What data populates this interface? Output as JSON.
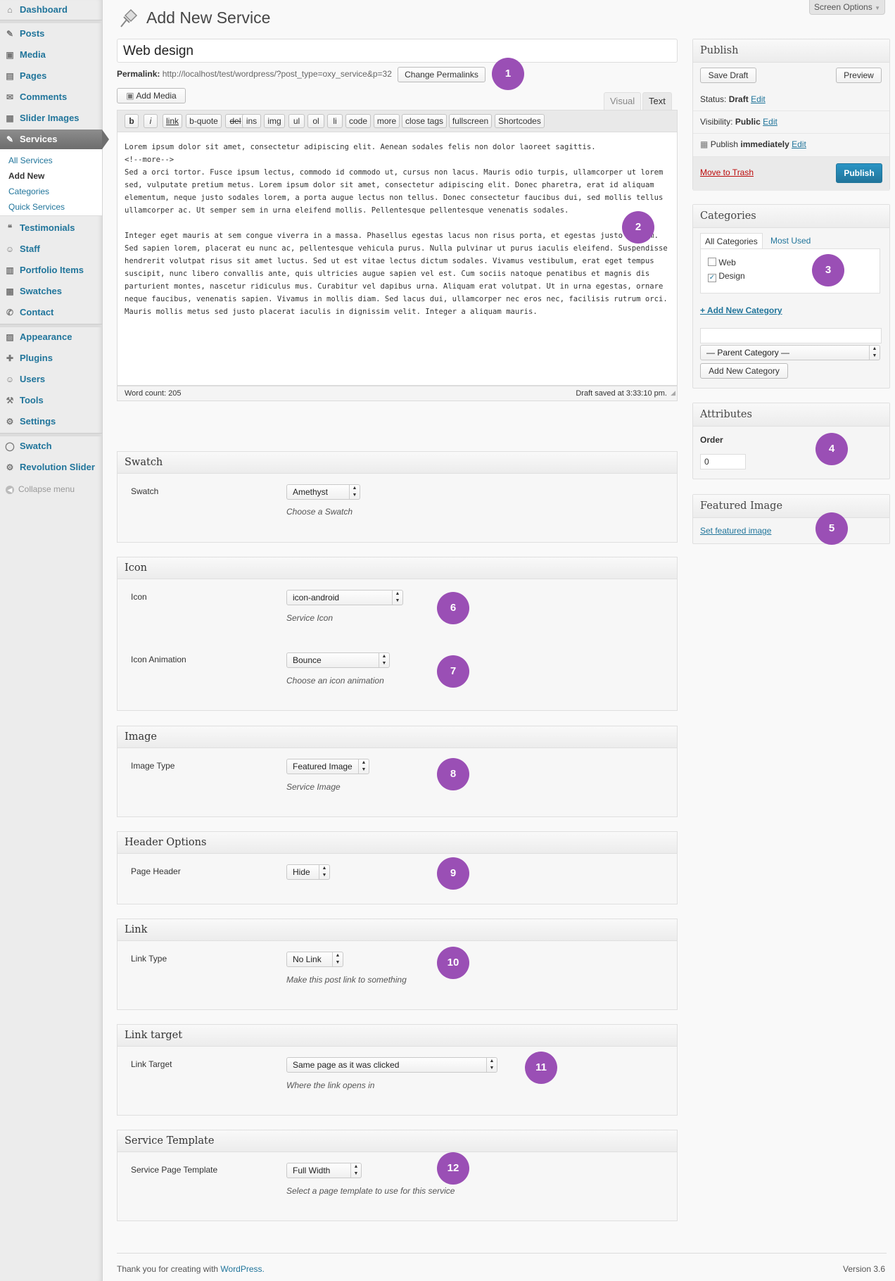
{
  "sidebar": {
    "items": [
      {
        "label": "Dashboard",
        "icon": "dashboard-icon",
        "glyph": "⌂"
      },
      {
        "label": "Posts",
        "icon": "pin-icon",
        "glyph": "✎"
      },
      {
        "label": "Media",
        "icon": "media-icon",
        "glyph": "▣"
      },
      {
        "label": "Pages",
        "icon": "pages-icon",
        "glyph": "▤"
      },
      {
        "label": "Comments",
        "icon": "comments-icon",
        "glyph": "✉"
      },
      {
        "label": "Slider Images",
        "icon": "image-icon",
        "glyph": "▦"
      },
      {
        "label": "Services",
        "icon": "wrench-icon",
        "glyph": "✎"
      },
      {
        "label": "Testimonials",
        "icon": "quote-icon",
        "glyph": "❝"
      },
      {
        "label": "Staff",
        "icon": "users-icon",
        "glyph": "☺"
      },
      {
        "label": "Portfolio Items",
        "icon": "portfolio-icon",
        "glyph": "▥"
      },
      {
        "label": "Swatches",
        "icon": "swatch-icon",
        "glyph": "▩"
      },
      {
        "label": "Contact",
        "icon": "contact-icon",
        "glyph": "✆"
      },
      {
        "label": "Appearance",
        "icon": "appearance-icon",
        "glyph": "▨"
      },
      {
        "label": "Plugins",
        "icon": "plugin-icon",
        "glyph": "✚"
      },
      {
        "label": "Users",
        "icon": "user-icon",
        "glyph": "☺"
      },
      {
        "label": "Tools",
        "icon": "tools-icon",
        "glyph": "⚒"
      },
      {
        "label": "Settings",
        "icon": "settings-icon",
        "glyph": "⚙"
      },
      {
        "label": "Swatch",
        "icon": "swatch-circle-icon",
        "glyph": "◯"
      },
      {
        "label": "Revolution Slider",
        "icon": "gear-icon",
        "glyph": "⚙"
      }
    ],
    "services_sub": [
      "All Services",
      "Add New",
      "Categories",
      "Quick Services"
    ],
    "collapse_label": "Collapse menu"
  },
  "header": {
    "screen_options": "Screen Options",
    "page_title": "Add New Service"
  },
  "post": {
    "title": "Web design",
    "permalink_label": "Permalink:",
    "permalink_url": "http://localhost/test/wordpress/?post_type=oxy_service&p=32",
    "change_permalinks": "Change Permalinks",
    "add_media": "Add Media",
    "tab_visual": "Visual",
    "tab_text": "Text",
    "quicktags": [
      "b",
      "i",
      "link",
      "b-quote",
      "del",
      "ins",
      "img",
      "ul",
      "ol",
      "li",
      "code",
      "more",
      "close tags",
      "fullscreen",
      "Shortcodes"
    ],
    "content": [
      "Lorem ipsum dolor sit amet, consectetur adipiscing elit. Aenean sodales felis non dolor laoreet sagittis.\n<!--more-->\nSed a orci tortor. Fusce ipsum lectus, commodo id commodo ut, cursus non lacus. Mauris odio turpis, ullamcorper ut lorem sed, vulputate pretium metus. Lorem ipsum dolor sit amet, consectetur adipiscing elit. Donec pharetra, erat id aliquam elementum, neque justo sodales lorem, a porta augue lectus non tellus. Donec consectetur faucibus dui, sed mollis tellus ullamcorper ac. Ut semper sem in urna eleifend mollis. Pellentesque pellentesque venenatis sodales.",
      "Integer eget mauris at sem congue viverra in a massa. Phasellus egestas lacus non risus porta, et egestas justo dictum. Sed sapien lorem, placerat eu nunc ac, pellentesque vehicula purus. Nulla pulvinar ut purus iaculis eleifend. Suspendisse hendrerit volutpat risus sit amet luctus. Sed ut est vitae lectus dictum sodales. Vivamus vestibulum, erat eget tempus suscipit, nunc libero convallis ante, quis ultricies augue sapien vel est. Cum sociis natoque penatibus et magnis dis parturient montes, nascetur ridiculus mus. Curabitur vel dapibus urna. Aliquam erat volutpat. Ut in urna egestas, ornare neque faucibus, venenatis sapien. Vivamus in mollis diam. Sed lacus dui, ullamcorper nec eros nec, facilisis rutrum orci. Mauris mollis metus sed justo placerat iaculis in dignissim velit. Integer a aliquam mauris."
    ],
    "word_count": "Word count: 205",
    "draft_saved": "Draft saved at 3:33:10 pm."
  },
  "publish": {
    "title": "Publish",
    "save_draft": "Save Draft",
    "preview": "Preview",
    "status_label": "Status:",
    "status_value": "Draft",
    "visibility_label": "Visibility:",
    "visibility_value": "Public",
    "publish_label": "Publish",
    "publish_value": "immediately",
    "edit": "Edit",
    "move_to_trash": "Move to Trash",
    "publish_button": "Publish"
  },
  "categories": {
    "title": "Categories",
    "tab_all": "All Categories",
    "tab_most_used": "Most Used",
    "items": [
      {
        "label": "Web",
        "checked": false
      },
      {
        "label": "Design",
        "checked": true
      }
    ],
    "add_new_link": "+ Add New Category",
    "parent_placeholder": "— Parent Category —",
    "add_button": "Add New Category"
  },
  "attributes": {
    "title": "Attributes",
    "order_label": "Order",
    "order_value": "0"
  },
  "featured_image": {
    "title": "Featured Image",
    "set_link": "Set featured image"
  },
  "metaboxes": {
    "swatch": {
      "title": "Swatch",
      "label": "Swatch",
      "value": "Amethyst",
      "desc": "Choose a Swatch"
    },
    "icon": {
      "title": "Icon",
      "label": "Icon",
      "value": "icon-android",
      "desc": "Service Icon",
      "anim_label": "Icon Animation",
      "anim_value": "Bounce",
      "anim_desc": "Choose an icon animation"
    },
    "image": {
      "title": "Image",
      "label": "Image Type",
      "value": "Featured Image",
      "desc": "Service Image"
    },
    "header": {
      "title": "Header Options",
      "label": "Page Header",
      "value": "Hide"
    },
    "link": {
      "title": "Link",
      "label": "Link Type",
      "value": "No Link",
      "desc": "Make this post link to something"
    },
    "link_target": {
      "title": "Link target",
      "label": "Link Target",
      "value": "Same page as it was clicked",
      "desc": "Where the link opens in"
    },
    "template": {
      "title": "Service Template",
      "label": "Service Page Template",
      "value": "Full Width",
      "desc": "Select a page template to use for this service"
    }
  },
  "badges": [
    "1",
    "2",
    "3",
    "4",
    "5",
    "6",
    "7",
    "8",
    "9",
    "10",
    "11",
    "12"
  ],
  "footer": {
    "thanks": "Thank you for creating with ",
    "wp_link": "WordPress.",
    "version": "Version 3.6"
  },
  "colors": {
    "accent": "#21759b",
    "badge": "#9a4fb5",
    "active_menu": "#777777"
  }
}
